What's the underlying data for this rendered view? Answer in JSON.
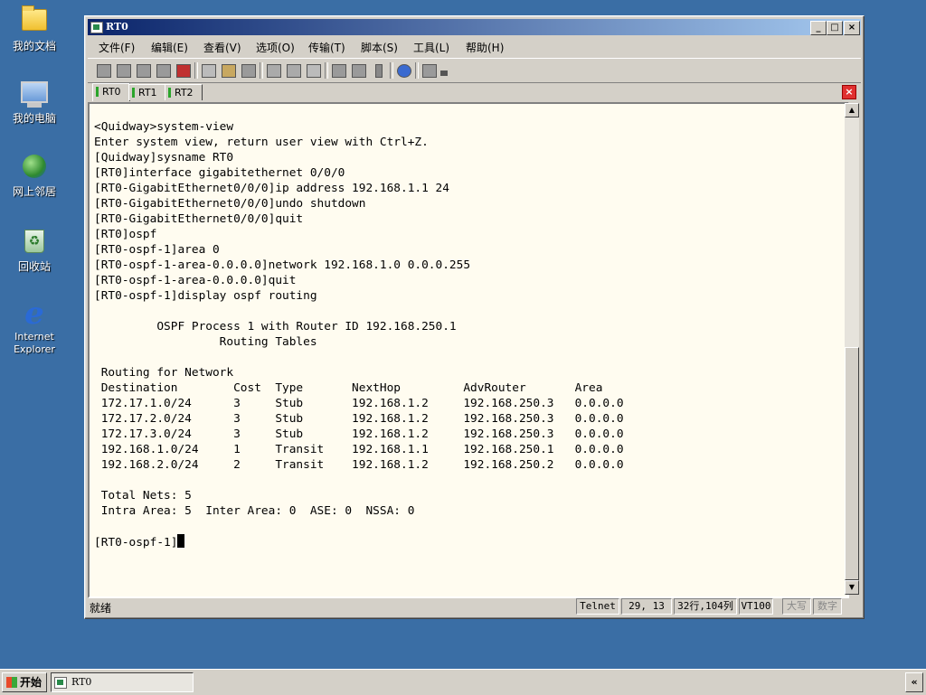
{
  "desktop": {
    "icons": [
      {
        "label": "我的文档",
        "icon": "folder-icon"
      },
      {
        "label": "我的电脑",
        "icon": "computer-icon"
      },
      {
        "label": "网上邻居",
        "icon": "network-icon"
      },
      {
        "label": "回收站",
        "icon": "recycle-bin-icon"
      },
      {
        "label": "Internet Explorer",
        "icon": "internet-explorer-icon"
      }
    ]
  },
  "window": {
    "title": "RT0",
    "minimize": "_",
    "maximize": "□",
    "close": "×"
  },
  "menu": [
    "文件(F)",
    "编辑(E)",
    "查看(V)",
    "选项(O)",
    "传输(T)",
    "脚本(S)",
    "工具(L)",
    "帮助(H)"
  ],
  "tabs": [
    "RT0",
    "RT1",
    "RT2"
  ],
  "active_tab": "RT0",
  "terminal": {
    "lines": [
      "<Quidway>system-view",
      "Enter system view, return user view with Ctrl+Z.",
      "[Quidway]sysname RT0",
      "[RT0]interface gigabitethernet 0/0/0",
      "[RT0-GigabitEthernet0/0/0]ip address 192.168.1.1 24",
      "[RT0-GigabitEthernet0/0/0]undo shutdown",
      "[RT0-GigabitEthernet0/0/0]quit",
      "[RT0]ospf",
      "[RT0-ospf-1]area 0",
      "[RT0-ospf-1-area-0.0.0.0]network 192.168.1.0 0.0.0.255",
      "[RT0-ospf-1-area-0.0.0.0]quit",
      "[RT0-ospf-1]display ospf routing",
      "",
      "         OSPF Process 1 with Router ID 192.168.250.1",
      "                  Routing Tables",
      "",
      " Routing for Network",
      " Destination        Cost  Type       NextHop         AdvRouter       Area",
      " 172.17.1.0/24      3     Stub       192.168.1.2     192.168.250.3   0.0.0.0",
      " 172.17.2.0/24      3     Stub       192.168.1.2     192.168.250.3   0.0.0.0",
      " 172.17.3.0/24      3     Stub       192.168.1.2     192.168.250.3   0.0.0.0",
      " 192.168.1.0/24     1     Transit    192.168.1.1     192.168.250.1   0.0.0.0",
      " 192.168.2.0/24     2     Transit    192.168.1.2     192.168.250.2   0.0.0.0",
      "",
      " Total Nets: 5",
      " Intra Area: 5  Inter Area: 0  ASE: 0  NSSA: 0",
      ""
    ],
    "prompt": "[RT0-ospf-1]"
  },
  "status": {
    "ready": "就绪",
    "protocol": "Telnet",
    "cursor_pos": "29,  13",
    "size": "32行,104列",
    "emulation": "VT100",
    "caps": "大写",
    "num": "数字"
  },
  "taskbar": {
    "start": "开始",
    "task": "RT0",
    "tray": "«"
  }
}
